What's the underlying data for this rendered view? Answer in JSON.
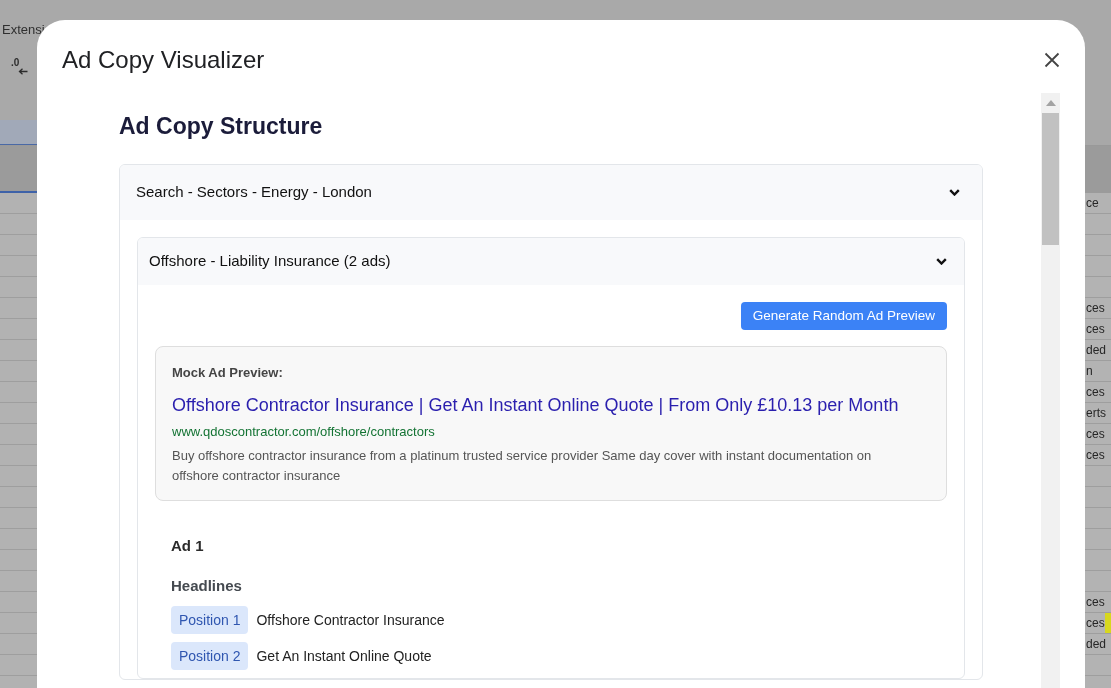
{
  "sheet": {
    "menu_item": "Extensi",
    "toolbar_button": ".0",
    "rows": [
      {
        "cell": "ce",
        "highlighted": false
      },
      {
        "highlighted": false
      },
      {
        "highlighted": false
      },
      {
        "highlighted": false
      },
      {
        "highlighted": false
      },
      {
        "cell": "ces",
        "highlighted": false
      },
      {
        "cell": "ces",
        "highlighted": false
      },
      {
        "cell": "ded",
        "highlighted": false
      },
      {
        "cell": "n",
        "highlighted": false
      },
      {
        "cell": "ces",
        "highlighted": false
      },
      {
        "cell": "erts",
        "highlighted": false
      },
      {
        "cell": "ces",
        "highlighted": false
      },
      {
        "cell": "ces",
        "highlighted": false
      },
      {
        "highlighted": false
      },
      {
        "highlighted": false
      },
      {
        "highlighted": false
      },
      {
        "highlighted": false
      },
      {
        "highlighted": false
      },
      {
        "highlighted": false
      },
      {
        "cell": "ces",
        "highlighted": false
      },
      {
        "cell": "ces",
        "highlighted": true
      },
      {
        "cell": "ded",
        "highlighted": false
      },
      {
        "highlighted": false
      }
    ]
  },
  "dialog": {
    "title": "Ad Copy Visualizer",
    "heading": "Ad Copy Structure",
    "campaigns": [
      {
        "name": "Search - Sectors - Energy - London",
        "expanded": true,
        "ad_groups": [
          {
            "name": "Offshore - Liability Insurance (2 ads)",
            "expanded": true,
            "generate_button": "Generate Random Ad Preview",
            "preview": {
              "label": "Mock Ad Preview:",
              "headline": "Offshore Contractor Insurance | Get An Instant Online Quote | From Only £10.13 per Month",
              "url": "www.qdoscontractor.com/offshore/contractors",
              "description": "Buy offshore contractor insurance from a platinum trusted service provider Same day cover with instant documentation on offshore contractor insurance"
            },
            "ads": [
              {
                "title": "Ad 1",
                "headlines_label": "Headlines",
                "headlines": [
                  {
                    "position": "Position 1",
                    "text": "Offshore Contractor Insurance"
                  },
                  {
                    "position": "Position 2",
                    "text": "Get An Instant Online Quote"
                  }
                ]
              }
            ]
          }
        ]
      }
    ]
  }
}
